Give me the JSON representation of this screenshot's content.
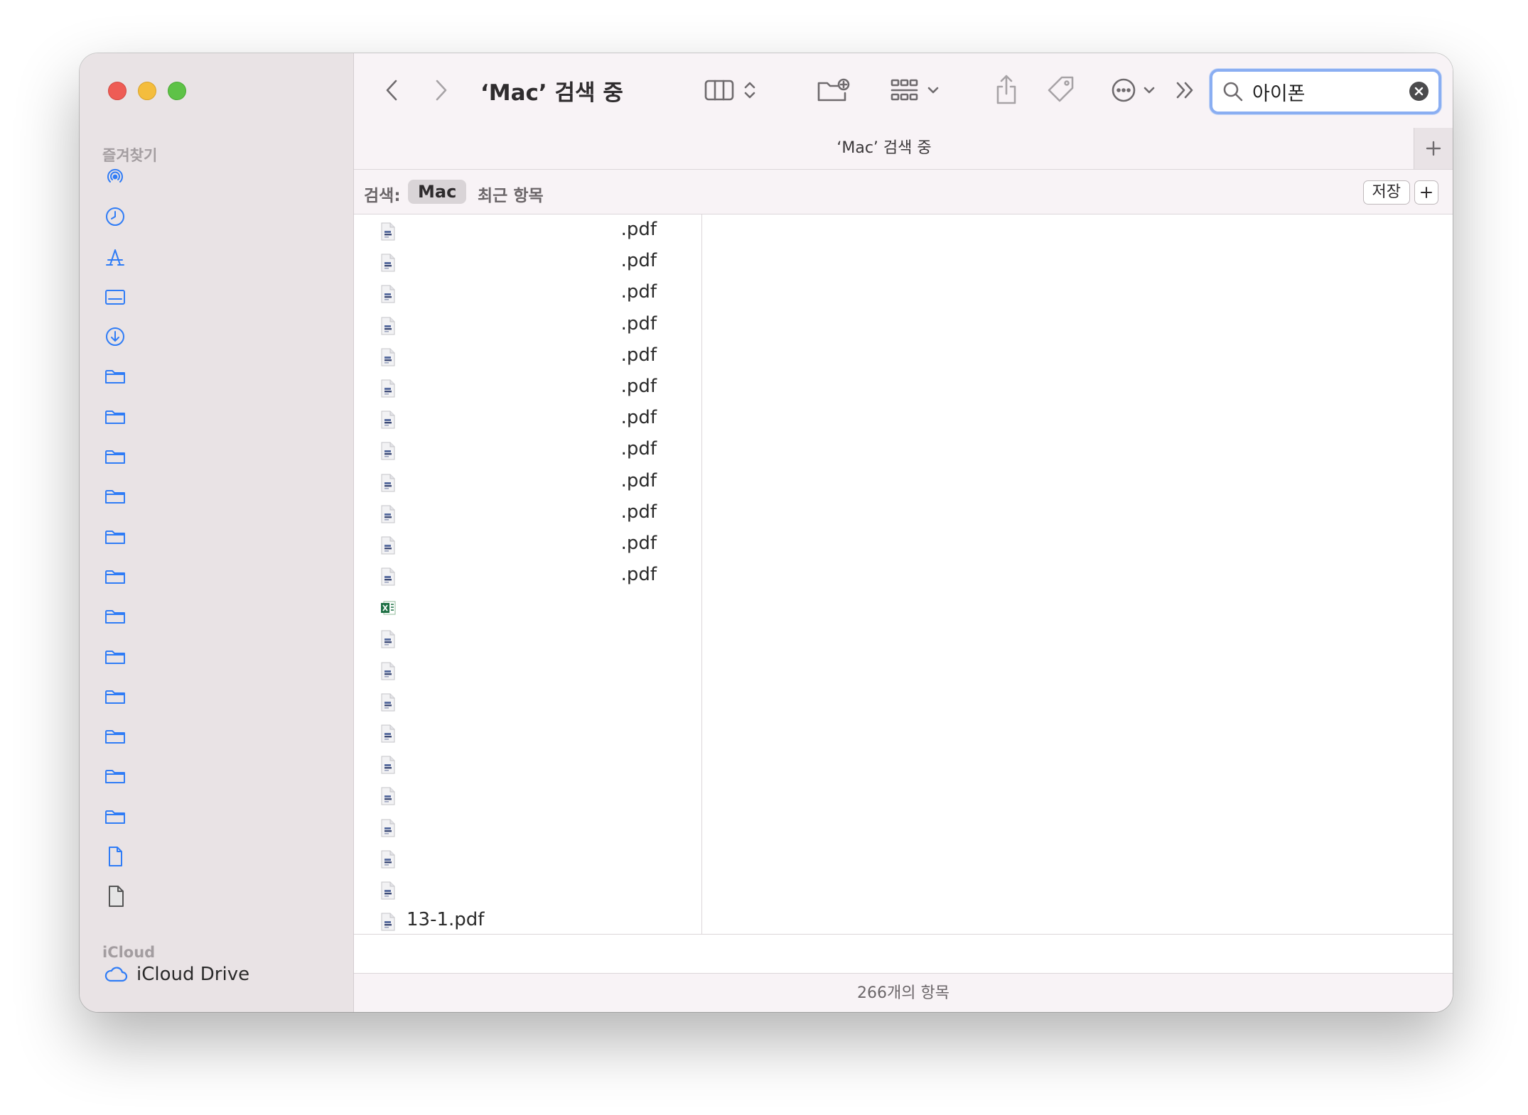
{
  "window": {
    "title": "‘Mac’ 검색 중"
  },
  "sidebar": {
    "favorites_title": "즐겨찾기",
    "favorites": [
      {
        "icon": "airdrop-icon"
      },
      {
        "icon": "recents-clock-icon"
      },
      {
        "icon": "applications-icon"
      },
      {
        "icon": "desktop-icon"
      },
      {
        "icon": "downloads-icon"
      },
      {
        "icon": "folder-icon"
      },
      {
        "icon": "folder-icon"
      },
      {
        "icon": "folder-icon"
      },
      {
        "icon": "folder-icon"
      },
      {
        "icon": "folder-icon"
      },
      {
        "icon": "folder-icon"
      },
      {
        "icon": "folder-icon"
      },
      {
        "icon": "folder-icon"
      },
      {
        "icon": "folder-icon"
      },
      {
        "icon": "folder-icon"
      },
      {
        "icon": "folder-icon"
      },
      {
        "icon": "folder-icon"
      },
      {
        "icon": "document-icon"
      },
      {
        "icon": "generic-file-icon"
      }
    ],
    "icloud_title": "iCloud",
    "icloud_drive_label": "iCloud Drive"
  },
  "toolbar": {
    "search_value": "아이폰"
  },
  "tabbar": {
    "tab_label": "‘Mac’ 검색 중"
  },
  "scope": {
    "label": "검색:",
    "mac": "Mac",
    "recent": "최근 항목",
    "save": "저장"
  },
  "files": [
    {
      "name": ".pdf",
      "type": "pdf"
    },
    {
      "name": ".pdf",
      "type": "pdf"
    },
    {
      "name": ".pdf",
      "type": "pdf"
    },
    {
      "name": ".pdf",
      "type": "pdf"
    },
    {
      "name": ".pdf",
      "type": "pdf"
    },
    {
      "name": ".pdf",
      "type": "pdf"
    },
    {
      "name": ".pdf",
      "type": "pdf"
    },
    {
      "name": ".pdf",
      "type": "pdf"
    },
    {
      "name": ".pdf",
      "type": "pdf"
    },
    {
      "name": ".pdf",
      "type": "pdf"
    },
    {
      "name": ".pdf",
      "type": "pdf"
    },
    {
      "name": ".pdf",
      "type": "pdf"
    },
    {
      "name": "",
      "type": "xlsx"
    },
    {
      "name": "",
      "type": "pdf"
    },
    {
      "name": "",
      "type": "pdf"
    },
    {
      "name": "",
      "type": "pdf"
    },
    {
      "name": "",
      "type": "pdf"
    },
    {
      "name": "",
      "type": "pdf"
    },
    {
      "name": "",
      "type": "pdf"
    },
    {
      "name": "",
      "type": "pdf"
    },
    {
      "name": "",
      "type": "pdf"
    },
    {
      "name": "",
      "type": "pdf"
    },
    {
      "name": "13-1.pdf",
      "type": "pdf"
    }
  ],
  "status": {
    "item_count": "266개의 항목"
  },
  "colors": {
    "accent": "#2f7cf6",
    "sidebar_bg": "#e9e3e5",
    "search_focus": "#8aaef2"
  }
}
